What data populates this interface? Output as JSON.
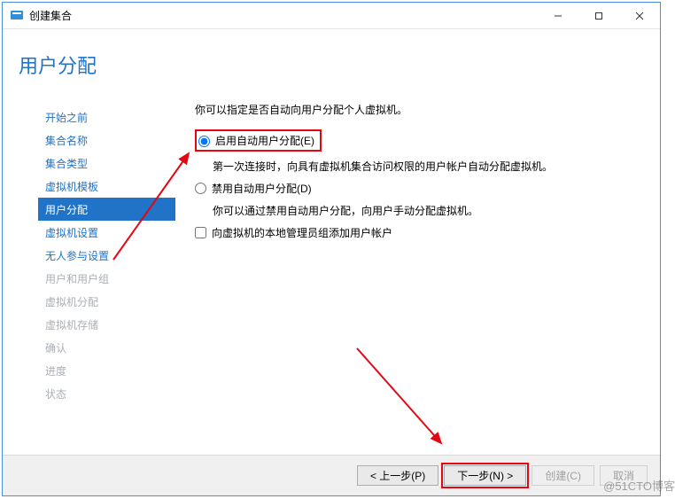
{
  "titlebar": {
    "title": "创建集合"
  },
  "page_title": "用户分配",
  "nav": {
    "items": [
      {
        "label": "开始之前",
        "state": "enabled"
      },
      {
        "label": "集合名称",
        "state": "enabled"
      },
      {
        "label": "集合类型",
        "state": "enabled"
      },
      {
        "label": "虚拟机模板",
        "state": "enabled"
      },
      {
        "label": "用户分配",
        "state": "active"
      },
      {
        "label": "虚拟机设置",
        "state": "enabled"
      },
      {
        "label": "无人参与设置",
        "state": "enabled"
      },
      {
        "label": "用户和用户组",
        "state": "disabled"
      },
      {
        "label": "虚拟机分配",
        "state": "disabled"
      },
      {
        "label": "虚拟机存储",
        "state": "disabled"
      },
      {
        "label": "确认",
        "state": "disabled"
      },
      {
        "label": "进度",
        "state": "disabled"
      },
      {
        "label": "状态",
        "state": "disabled"
      }
    ]
  },
  "main": {
    "instruction": "你可以指定是否自动向用户分配个人虚拟机。",
    "opt_enable_label": "启用自动用户分配(E)",
    "opt_enable_desc": "第一次连接时，向具有虚拟机集合访问权限的用户帐户自动分配虚拟机。",
    "opt_disable_label": "禁用自动用户分配(D)",
    "opt_disable_desc": "你可以通过禁用自动用户分配，向用户手动分配虚拟机。",
    "chk_admin_label": "向虚拟机的本地管理员组添加用户帐户"
  },
  "footer": {
    "prev": "< 上一步(P)",
    "next": "下一步(N) >",
    "create": "创建(C)",
    "cancel": "取消"
  },
  "watermark": "@51CTO博客"
}
